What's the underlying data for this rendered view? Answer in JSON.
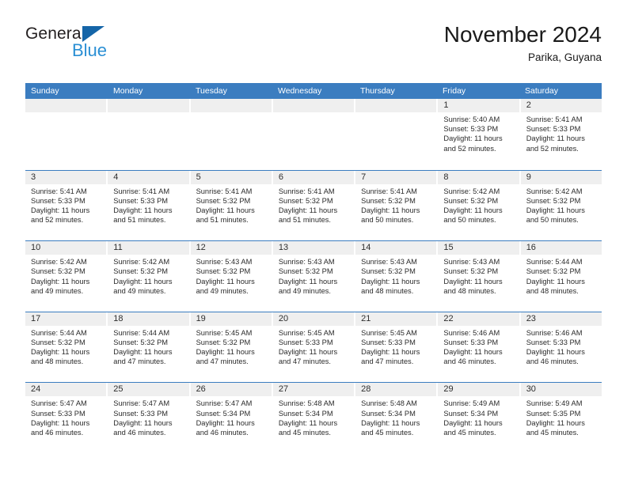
{
  "brand": {
    "name_part1": "General",
    "name_part2": "Blue"
  },
  "header": {
    "title": "November 2024",
    "subtitle": "Parika, Guyana"
  },
  "colors": {
    "header_blue": "#3b7dc0",
    "brand_blue": "#2a8fd4",
    "logo_triangle": "#1565a8",
    "day_number_bg": "#efefef"
  },
  "weekdays": [
    "Sunday",
    "Monday",
    "Tuesday",
    "Wednesday",
    "Thursday",
    "Friday",
    "Saturday"
  ],
  "weeks": [
    [
      {
        "day": "",
        "empty": true
      },
      {
        "day": "",
        "empty": true
      },
      {
        "day": "",
        "empty": true
      },
      {
        "day": "",
        "empty": true
      },
      {
        "day": "",
        "empty": true
      },
      {
        "day": "1",
        "sunrise": "Sunrise: 5:40 AM",
        "sunset": "Sunset: 5:33 PM",
        "daylight": "Daylight: 11 hours and 52 minutes."
      },
      {
        "day": "2",
        "sunrise": "Sunrise: 5:41 AM",
        "sunset": "Sunset: 5:33 PM",
        "daylight": "Daylight: 11 hours and 52 minutes."
      }
    ],
    [
      {
        "day": "3",
        "sunrise": "Sunrise: 5:41 AM",
        "sunset": "Sunset: 5:33 PM",
        "daylight": "Daylight: 11 hours and 52 minutes."
      },
      {
        "day": "4",
        "sunrise": "Sunrise: 5:41 AM",
        "sunset": "Sunset: 5:33 PM",
        "daylight": "Daylight: 11 hours and 51 minutes."
      },
      {
        "day": "5",
        "sunrise": "Sunrise: 5:41 AM",
        "sunset": "Sunset: 5:32 PM",
        "daylight": "Daylight: 11 hours and 51 minutes."
      },
      {
        "day": "6",
        "sunrise": "Sunrise: 5:41 AM",
        "sunset": "Sunset: 5:32 PM",
        "daylight": "Daylight: 11 hours and 51 minutes."
      },
      {
        "day": "7",
        "sunrise": "Sunrise: 5:41 AM",
        "sunset": "Sunset: 5:32 PM",
        "daylight": "Daylight: 11 hours and 50 minutes."
      },
      {
        "day": "8",
        "sunrise": "Sunrise: 5:42 AM",
        "sunset": "Sunset: 5:32 PM",
        "daylight": "Daylight: 11 hours and 50 minutes."
      },
      {
        "day": "9",
        "sunrise": "Sunrise: 5:42 AM",
        "sunset": "Sunset: 5:32 PM",
        "daylight": "Daylight: 11 hours and 50 minutes."
      }
    ],
    [
      {
        "day": "10",
        "sunrise": "Sunrise: 5:42 AM",
        "sunset": "Sunset: 5:32 PM",
        "daylight": "Daylight: 11 hours and 49 minutes."
      },
      {
        "day": "11",
        "sunrise": "Sunrise: 5:42 AM",
        "sunset": "Sunset: 5:32 PM",
        "daylight": "Daylight: 11 hours and 49 minutes."
      },
      {
        "day": "12",
        "sunrise": "Sunrise: 5:43 AM",
        "sunset": "Sunset: 5:32 PM",
        "daylight": "Daylight: 11 hours and 49 minutes."
      },
      {
        "day": "13",
        "sunrise": "Sunrise: 5:43 AM",
        "sunset": "Sunset: 5:32 PM",
        "daylight": "Daylight: 11 hours and 49 minutes."
      },
      {
        "day": "14",
        "sunrise": "Sunrise: 5:43 AM",
        "sunset": "Sunset: 5:32 PM",
        "daylight": "Daylight: 11 hours and 48 minutes."
      },
      {
        "day": "15",
        "sunrise": "Sunrise: 5:43 AM",
        "sunset": "Sunset: 5:32 PM",
        "daylight": "Daylight: 11 hours and 48 minutes."
      },
      {
        "day": "16",
        "sunrise": "Sunrise: 5:44 AM",
        "sunset": "Sunset: 5:32 PM",
        "daylight": "Daylight: 11 hours and 48 minutes."
      }
    ],
    [
      {
        "day": "17",
        "sunrise": "Sunrise: 5:44 AM",
        "sunset": "Sunset: 5:32 PM",
        "daylight": "Daylight: 11 hours and 48 minutes."
      },
      {
        "day": "18",
        "sunrise": "Sunrise: 5:44 AM",
        "sunset": "Sunset: 5:32 PM",
        "daylight": "Daylight: 11 hours and 47 minutes."
      },
      {
        "day": "19",
        "sunrise": "Sunrise: 5:45 AM",
        "sunset": "Sunset: 5:32 PM",
        "daylight": "Daylight: 11 hours and 47 minutes."
      },
      {
        "day": "20",
        "sunrise": "Sunrise: 5:45 AM",
        "sunset": "Sunset: 5:33 PM",
        "daylight": "Daylight: 11 hours and 47 minutes."
      },
      {
        "day": "21",
        "sunrise": "Sunrise: 5:45 AM",
        "sunset": "Sunset: 5:33 PM",
        "daylight": "Daylight: 11 hours and 47 minutes."
      },
      {
        "day": "22",
        "sunrise": "Sunrise: 5:46 AM",
        "sunset": "Sunset: 5:33 PM",
        "daylight": "Daylight: 11 hours and 46 minutes."
      },
      {
        "day": "23",
        "sunrise": "Sunrise: 5:46 AM",
        "sunset": "Sunset: 5:33 PM",
        "daylight": "Daylight: 11 hours and 46 minutes."
      }
    ],
    [
      {
        "day": "24",
        "sunrise": "Sunrise: 5:47 AM",
        "sunset": "Sunset: 5:33 PM",
        "daylight": "Daylight: 11 hours and 46 minutes."
      },
      {
        "day": "25",
        "sunrise": "Sunrise: 5:47 AM",
        "sunset": "Sunset: 5:33 PM",
        "daylight": "Daylight: 11 hours and 46 minutes."
      },
      {
        "day": "26",
        "sunrise": "Sunrise: 5:47 AM",
        "sunset": "Sunset: 5:34 PM",
        "daylight": "Daylight: 11 hours and 46 minutes."
      },
      {
        "day": "27",
        "sunrise": "Sunrise: 5:48 AM",
        "sunset": "Sunset: 5:34 PM",
        "daylight": "Daylight: 11 hours and 45 minutes."
      },
      {
        "day": "28",
        "sunrise": "Sunrise: 5:48 AM",
        "sunset": "Sunset: 5:34 PM",
        "daylight": "Daylight: 11 hours and 45 minutes."
      },
      {
        "day": "29",
        "sunrise": "Sunrise: 5:49 AM",
        "sunset": "Sunset: 5:34 PM",
        "daylight": "Daylight: 11 hours and 45 minutes."
      },
      {
        "day": "30",
        "sunrise": "Sunrise: 5:49 AM",
        "sunset": "Sunset: 5:35 PM",
        "daylight": "Daylight: 11 hours and 45 minutes."
      }
    ]
  ]
}
